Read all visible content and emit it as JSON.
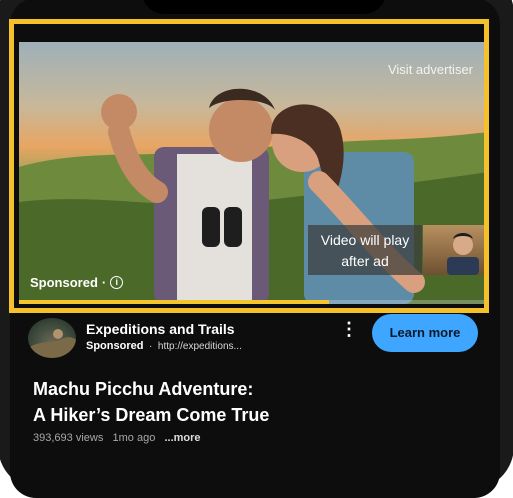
{
  "ad": {
    "visit_label": "Visit advertiser",
    "sponsored_label": "Sponsored",
    "sponsored_sep": "·",
    "info_icon": "i",
    "skip_text": "Video will play after ad",
    "progress_fraction": 0.66,
    "highlight_color": "#f4c12b"
  },
  "channel": {
    "name": "Expeditions and Trails",
    "sponsored": "Sponsored",
    "dot": "·",
    "url": "http://expeditions...",
    "kebab": "⋮",
    "cta_label": "Learn more",
    "cta_color": "#3ea6ff"
  },
  "video": {
    "title": "Machu Picchu Adventure: A Hiker’s Dream Come True",
    "views": "393,693 views",
    "age": "1mo ago",
    "more": "...more"
  }
}
